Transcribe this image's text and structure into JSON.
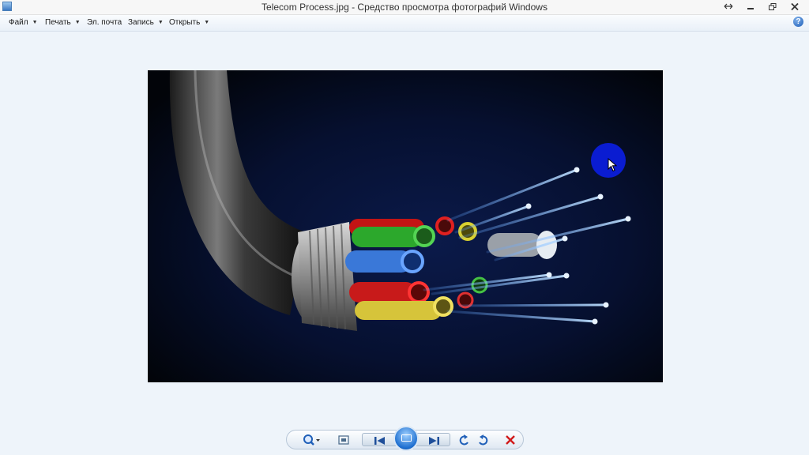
{
  "window": {
    "title": "Telecom Process.jpg - Средство просмотра фотографий Windows",
    "buttons": [
      "resize-icon",
      "minimize-icon",
      "maximize-icon",
      "close-icon"
    ]
  },
  "menu": {
    "items": [
      {
        "label": "Файл",
        "has_dropdown": true
      },
      {
        "label": "Печать",
        "has_dropdown": true
      },
      {
        "label": "Эл. почта",
        "has_dropdown": false
      },
      {
        "label": "Запись",
        "has_dropdown": true
      },
      {
        "label": "Открыть",
        "has_dropdown": true
      }
    ],
    "help_symbol": "?"
  },
  "viewer": {
    "image_subject": "fiber optic cable with colored tubes and glowing fibers",
    "background_color": "#eef4fa"
  },
  "controls": {
    "icons": [
      "zoom-icon",
      "actual-size-icon",
      "previous-icon",
      "slideshow-icon",
      "next-icon",
      "rotate-ccw-icon",
      "rotate-cw-icon",
      "delete-icon"
    ]
  },
  "colors": {
    "cursor_highlight": "#0b1de0",
    "accent": "#1e6fd0",
    "delete": "#d11a1a"
  }
}
